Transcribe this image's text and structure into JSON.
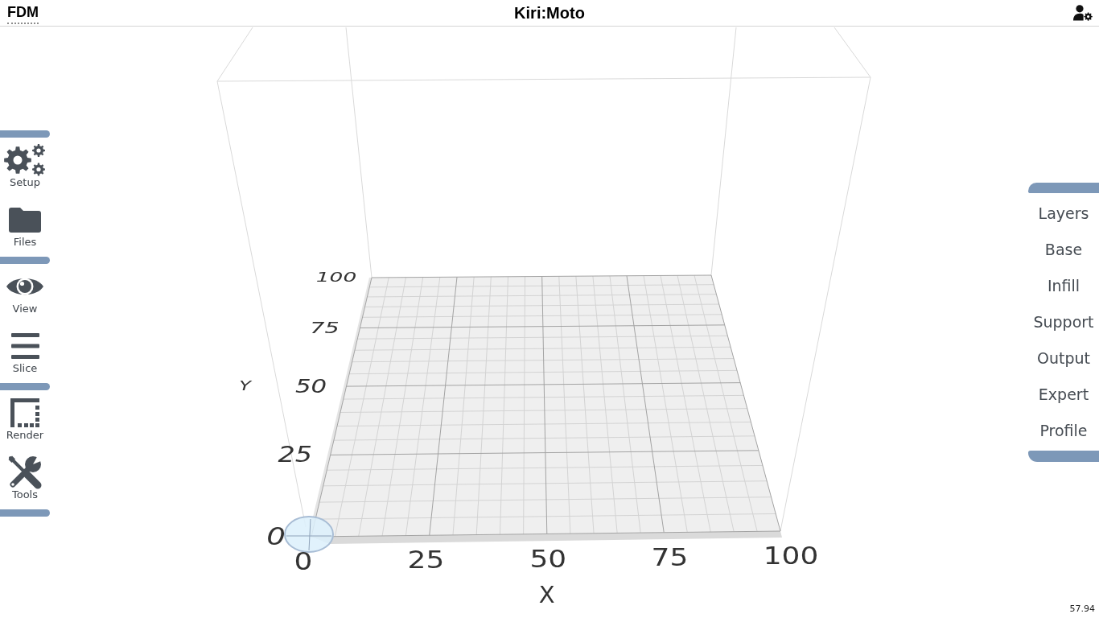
{
  "top_bar": {
    "mode": "FDM",
    "title": "Kiri:Moto"
  },
  "left_menu": {
    "groups": [
      {
        "items": [
          "Setup",
          "Files"
        ]
      },
      {
        "items": [
          "View",
          "Slice"
        ]
      },
      {
        "items": [
          "Render",
          "Tools"
        ]
      }
    ]
  },
  "right_menu": {
    "items": [
      "Layers",
      "Base",
      "Infill",
      "Support",
      "Output",
      "Expert",
      "Profile"
    ]
  },
  "viewport": {
    "x_axis": {
      "title": "X",
      "ticks": [
        "0",
        "25",
        "50",
        "75",
        "100"
      ]
    },
    "y_axis": {
      "title": "Y",
      "ticks": [
        "0",
        "25",
        "50",
        "75",
        "100"
      ]
    }
  },
  "status": {
    "fps": "57.94"
  }
}
